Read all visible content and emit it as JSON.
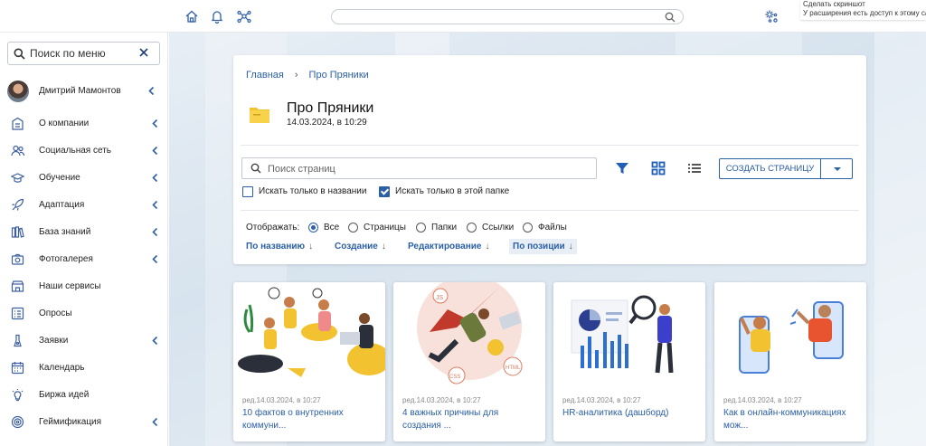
{
  "tooltip": {
    "line1": "Сделать скриншот",
    "line2": "У расширения есть доступ к этому сайту"
  },
  "topbar": {
    "icons": [
      "home-icon",
      "bell-icon",
      "network-icon"
    ],
    "settings_icon": "settings-network-icon",
    "search_placeholder": ""
  },
  "sidebar": {
    "search_placeholder": "Поиск по меню",
    "user_name": "Дмитрий Мамонтов",
    "items": [
      {
        "label": "О компании",
        "icon": "building-icon",
        "has_children": true
      },
      {
        "label": "Социальная сеть",
        "icon": "users-icon",
        "has_children": true
      },
      {
        "label": "Обучение",
        "icon": "graduation-cap-icon",
        "has_children": true
      },
      {
        "label": "Адаптация",
        "icon": "rocket-icon",
        "has_children": true
      },
      {
        "label": "База знаний",
        "icon": "books-icon",
        "has_children": true
      },
      {
        "label": "Фотогалерея",
        "icon": "camera-icon",
        "has_children": true
      },
      {
        "label": "Наши сервисы",
        "icon": "services-icon",
        "has_children": false
      },
      {
        "label": "Опросы",
        "icon": "checklist-icon",
        "has_children": false
      },
      {
        "label": "Заявки",
        "icon": "request-icon",
        "has_children": true
      },
      {
        "label": "Календарь",
        "icon": "calendar-icon",
        "has_children": false
      },
      {
        "label": "Биржа идей",
        "icon": "lightbulb-icon",
        "has_children": false
      },
      {
        "label": "Геймификация",
        "icon": "target-icon",
        "has_children": true
      }
    ]
  },
  "panel": {
    "breadcrumb": {
      "home": "Главная",
      "separator": "›",
      "current": "Про Пряники"
    },
    "title": "Про Пряники",
    "date": "14.03.2024, в 10:29",
    "search_placeholder": "Поиск страниц",
    "create_button": "СОЗДАТЬ СТРАНИЦУ",
    "check_title_only": {
      "label": "Искать только в названии",
      "checked": false
    },
    "check_folder_only": {
      "label": "Искать только в этой папке",
      "checked": true
    },
    "show_label": "Отображать:",
    "show_options": [
      {
        "label": "Все",
        "selected": true
      },
      {
        "label": "Страницы",
        "selected": false
      },
      {
        "label": "Папки",
        "selected": false
      },
      {
        "label": "Ссылки",
        "selected": false
      },
      {
        "label": "Файлы",
        "selected": false
      }
    ],
    "sort_options": [
      {
        "label": "По названию",
        "arrow": "↓"
      },
      {
        "label": "Создание",
        "arrow": "↓"
      },
      {
        "label": "Редактирование",
        "arrow": "↓"
      },
      {
        "label": "По позиции",
        "arrow": "↓",
        "active": true
      }
    ]
  },
  "cards": [
    {
      "edited": "ред.14.03.2024, в 10:27",
      "title": "10 фактов о внутренних коммуни..."
    },
    {
      "edited": "ред.14.03.2024, в 10:27",
      "title": "4 важных причины для создания ..."
    },
    {
      "edited": "ред.14.03.2024, в 10:27",
      "title": "HR-аналитика (дашборд)"
    },
    {
      "edited": "ред.14.03.2024, в 10:27",
      "title": "Как в онлайн-коммуникациях мож..."
    }
  ],
  "colors": {
    "accent": "#2b5fa6",
    "icon": "#3d5fa0"
  }
}
